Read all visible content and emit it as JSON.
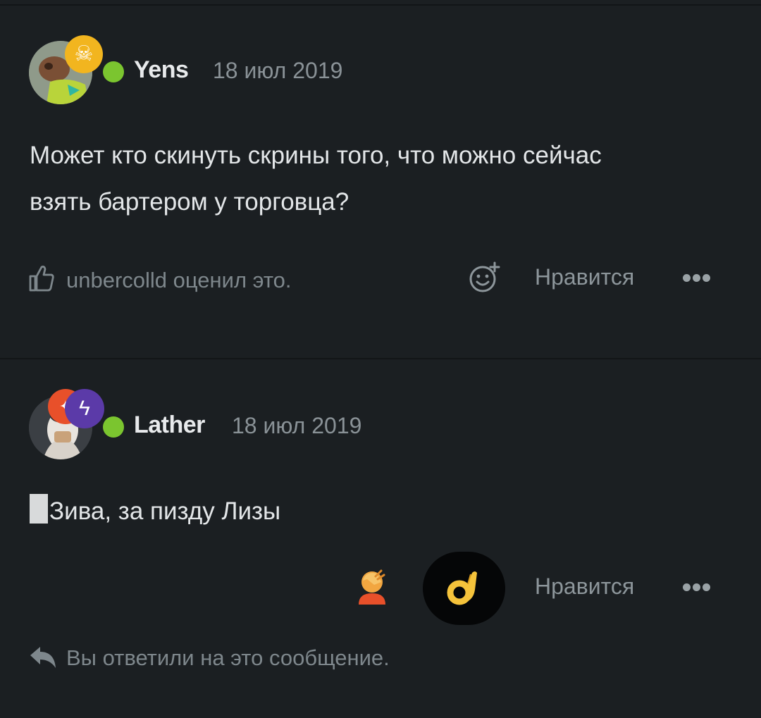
{
  "posts": [
    {
      "username": "Yens",
      "date": "18 июл 2019",
      "badge_icon": "skull-icon",
      "text_line1": "Может кто скинуть скрины того, что можно сейчас",
      "text_line2": "взять бартером у торговца?",
      "reaction_summary": "unbercolld оценил это.",
      "like_label": "Нравится"
    },
    {
      "username": "Lather",
      "date": "18 июл 2019",
      "badge_icon": "lightning-icon",
      "text": "Зива, за пизду Лизы",
      "like_label": "Нравится",
      "reply_notice": "Вы ответили на это сообщение."
    }
  ],
  "colors": {
    "background": "#1b1f22",
    "online": "#7bc52f",
    "badge_gold": "#f2b51f",
    "badge_purple": "#5b3aa8",
    "badge_orange": "#e8502a"
  }
}
